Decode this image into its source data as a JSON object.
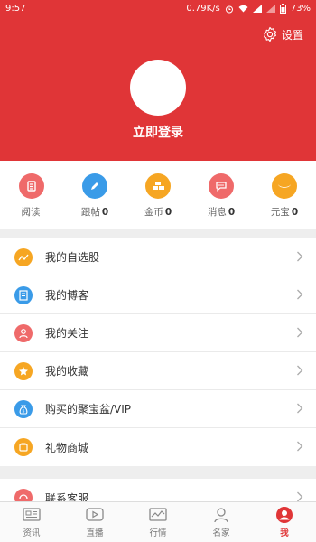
{
  "status_bar": {
    "time": "9:57",
    "network_speed": "0.79K/s",
    "battery": "73%"
  },
  "header": {
    "settings_label": "设置",
    "login_label": "立即登录",
    "bg_color": "#e03537"
  },
  "stats": [
    {
      "label": "阅读",
      "count": "",
      "icon": "book-icon",
      "color": "#ef6a6a"
    },
    {
      "label": "跟帖",
      "count": "0",
      "icon": "pencil-icon",
      "color": "#3a9be8"
    },
    {
      "label": "金币",
      "count": "0",
      "icon": "gold-bars-icon",
      "color": "#f6a623"
    },
    {
      "label": "消息",
      "count": "0",
      "icon": "chat-icon",
      "color": "#ef6a6a"
    },
    {
      "label": "元宝",
      "count": "0",
      "icon": "ingot-icon",
      "color": "#f6a623"
    }
  ],
  "menu": [
    {
      "label": "我的自选股",
      "icon": "stock-trend-icon",
      "color": "#f6a623"
    },
    {
      "label": "我的博客",
      "icon": "blog-icon",
      "color": "#3a9be8"
    },
    {
      "label": "我的关注",
      "icon": "follow-user-icon",
      "color": "#ef6a6a"
    },
    {
      "label": "我的收藏",
      "icon": "star-icon",
      "color": "#f6a623"
    },
    {
      "label": "购买的聚宝盆/VIP",
      "icon": "money-bag-icon",
      "color": "#3a9be8"
    },
    {
      "label": "礼物商城",
      "icon": "gift-shop-icon",
      "color": "#f6a623"
    }
  ],
  "menu2": [
    {
      "label": "联系客服",
      "icon": "customer-service-icon",
      "color": "#ef6a6a"
    }
  ],
  "tabs": [
    {
      "label": "资讯",
      "icon": "news-icon",
      "active": false
    },
    {
      "label": "直播",
      "icon": "live-icon",
      "active": false
    },
    {
      "label": "行情",
      "icon": "market-icon",
      "active": false
    },
    {
      "label": "名家",
      "icon": "expert-icon",
      "active": false
    },
    {
      "label": "我",
      "icon": "me-icon",
      "active": true
    }
  ]
}
